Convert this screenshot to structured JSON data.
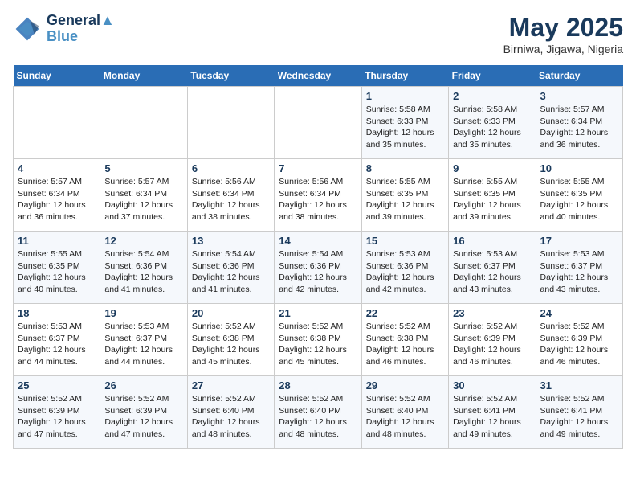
{
  "header": {
    "logo_line1": "General",
    "logo_line2": "Blue",
    "month": "May 2025",
    "location": "Birniwa, Jigawa, Nigeria"
  },
  "weekdays": [
    "Sunday",
    "Monday",
    "Tuesday",
    "Wednesday",
    "Thursday",
    "Friday",
    "Saturday"
  ],
  "weeks": [
    [
      {
        "day": "",
        "info": ""
      },
      {
        "day": "",
        "info": ""
      },
      {
        "day": "",
        "info": ""
      },
      {
        "day": "",
        "info": ""
      },
      {
        "day": "1",
        "info": "Sunrise: 5:58 AM\nSunset: 6:33 PM\nDaylight: 12 hours\nand 35 minutes."
      },
      {
        "day": "2",
        "info": "Sunrise: 5:58 AM\nSunset: 6:33 PM\nDaylight: 12 hours\nand 35 minutes."
      },
      {
        "day": "3",
        "info": "Sunrise: 5:57 AM\nSunset: 6:34 PM\nDaylight: 12 hours\nand 36 minutes."
      }
    ],
    [
      {
        "day": "4",
        "info": "Sunrise: 5:57 AM\nSunset: 6:34 PM\nDaylight: 12 hours\nand 36 minutes."
      },
      {
        "day": "5",
        "info": "Sunrise: 5:57 AM\nSunset: 6:34 PM\nDaylight: 12 hours\nand 37 minutes."
      },
      {
        "day": "6",
        "info": "Sunrise: 5:56 AM\nSunset: 6:34 PM\nDaylight: 12 hours\nand 38 minutes."
      },
      {
        "day": "7",
        "info": "Sunrise: 5:56 AM\nSunset: 6:34 PM\nDaylight: 12 hours\nand 38 minutes."
      },
      {
        "day": "8",
        "info": "Sunrise: 5:55 AM\nSunset: 6:35 PM\nDaylight: 12 hours\nand 39 minutes."
      },
      {
        "day": "9",
        "info": "Sunrise: 5:55 AM\nSunset: 6:35 PM\nDaylight: 12 hours\nand 39 minutes."
      },
      {
        "day": "10",
        "info": "Sunrise: 5:55 AM\nSunset: 6:35 PM\nDaylight: 12 hours\nand 40 minutes."
      }
    ],
    [
      {
        "day": "11",
        "info": "Sunrise: 5:55 AM\nSunset: 6:35 PM\nDaylight: 12 hours\nand 40 minutes."
      },
      {
        "day": "12",
        "info": "Sunrise: 5:54 AM\nSunset: 6:36 PM\nDaylight: 12 hours\nand 41 minutes."
      },
      {
        "day": "13",
        "info": "Sunrise: 5:54 AM\nSunset: 6:36 PM\nDaylight: 12 hours\nand 41 minutes."
      },
      {
        "day": "14",
        "info": "Sunrise: 5:54 AM\nSunset: 6:36 PM\nDaylight: 12 hours\nand 42 minutes."
      },
      {
        "day": "15",
        "info": "Sunrise: 5:53 AM\nSunset: 6:36 PM\nDaylight: 12 hours\nand 42 minutes."
      },
      {
        "day": "16",
        "info": "Sunrise: 5:53 AM\nSunset: 6:37 PM\nDaylight: 12 hours\nand 43 minutes."
      },
      {
        "day": "17",
        "info": "Sunrise: 5:53 AM\nSunset: 6:37 PM\nDaylight: 12 hours\nand 43 minutes."
      }
    ],
    [
      {
        "day": "18",
        "info": "Sunrise: 5:53 AM\nSunset: 6:37 PM\nDaylight: 12 hours\nand 44 minutes."
      },
      {
        "day": "19",
        "info": "Sunrise: 5:53 AM\nSunset: 6:37 PM\nDaylight: 12 hours\nand 44 minutes."
      },
      {
        "day": "20",
        "info": "Sunrise: 5:52 AM\nSunset: 6:38 PM\nDaylight: 12 hours\nand 45 minutes."
      },
      {
        "day": "21",
        "info": "Sunrise: 5:52 AM\nSunset: 6:38 PM\nDaylight: 12 hours\nand 45 minutes."
      },
      {
        "day": "22",
        "info": "Sunrise: 5:52 AM\nSunset: 6:38 PM\nDaylight: 12 hours\nand 46 minutes."
      },
      {
        "day": "23",
        "info": "Sunrise: 5:52 AM\nSunset: 6:39 PM\nDaylight: 12 hours\nand 46 minutes."
      },
      {
        "day": "24",
        "info": "Sunrise: 5:52 AM\nSunset: 6:39 PM\nDaylight: 12 hours\nand 46 minutes."
      }
    ],
    [
      {
        "day": "25",
        "info": "Sunrise: 5:52 AM\nSunset: 6:39 PM\nDaylight: 12 hours\nand 47 minutes."
      },
      {
        "day": "26",
        "info": "Sunrise: 5:52 AM\nSunset: 6:39 PM\nDaylight: 12 hours\nand 47 minutes."
      },
      {
        "day": "27",
        "info": "Sunrise: 5:52 AM\nSunset: 6:40 PM\nDaylight: 12 hours\nand 48 minutes."
      },
      {
        "day": "28",
        "info": "Sunrise: 5:52 AM\nSunset: 6:40 PM\nDaylight: 12 hours\nand 48 minutes."
      },
      {
        "day": "29",
        "info": "Sunrise: 5:52 AM\nSunset: 6:40 PM\nDaylight: 12 hours\nand 48 minutes."
      },
      {
        "day": "30",
        "info": "Sunrise: 5:52 AM\nSunset: 6:41 PM\nDaylight: 12 hours\nand 49 minutes."
      },
      {
        "day": "31",
        "info": "Sunrise: 5:52 AM\nSunset: 6:41 PM\nDaylight: 12 hours\nand 49 minutes."
      }
    ]
  ]
}
